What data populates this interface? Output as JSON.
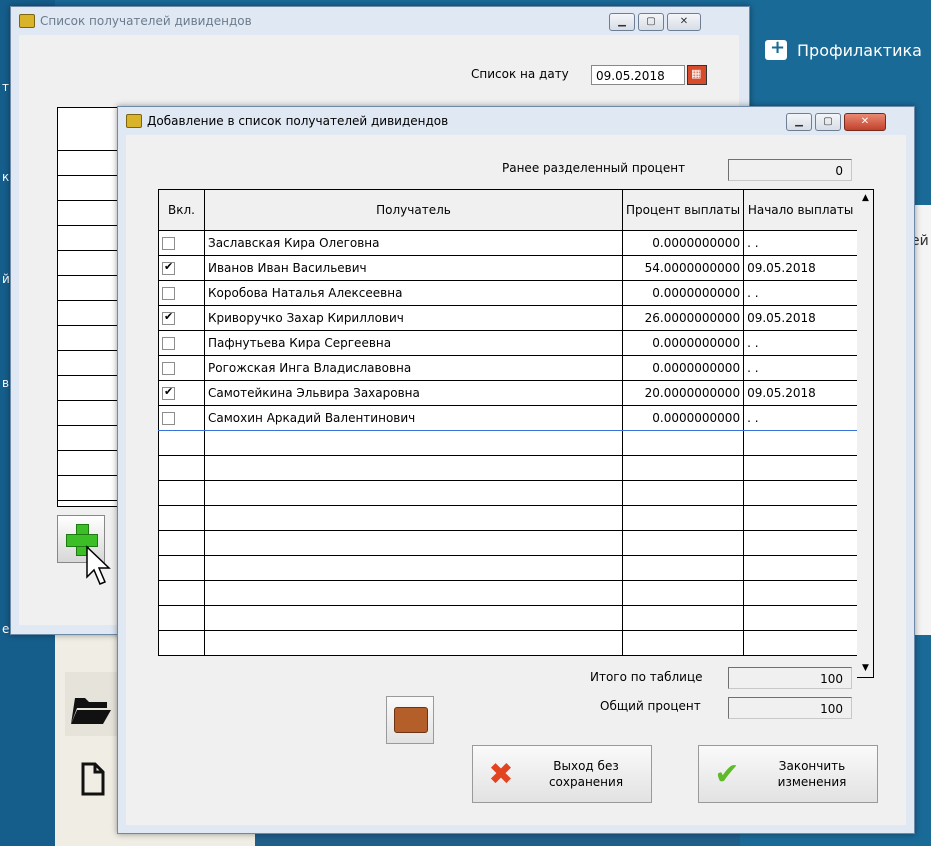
{
  "background": {
    "right_title": "Профилактика",
    "right_panel_text": "ей",
    "left_letters": [
      "т",
      "к",
      "й",
      "в",
      "е"
    ]
  },
  "window1": {
    "title": "Список получателей дивидендов",
    "date_label": "Список на дату",
    "date_value": "09.05.2018",
    "add_icon": "plus-icon"
  },
  "window2": {
    "title": "Добавление в список получателей дивидендов",
    "prev_percent_label": "Ранее разделенный процент",
    "prev_percent_value": "0",
    "columns": [
      "Вкл.",
      "Получатель",
      "Процент выплаты",
      "Начало выплаты"
    ],
    "rows": [
      {
        "checked": false,
        "name": "Заславская Кира Олеговна",
        "percent": "0.0000000000",
        "start": ". ."
      },
      {
        "checked": true,
        "name": "Иванов Иван Васильевич",
        "percent": "54.0000000000",
        "start": "09.05.2018"
      },
      {
        "checked": false,
        "name": "Коробова Наталья Алексеевна",
        "percent": "0.0000000000",
        "start": ". ."
      },
      {
        "checked": true,
        "name": "Криворучко Захар Кириллович",
        "percent": "26.0000000000",
        "start": "09.05.2018"
      },
      {
        "checked": false,
        "name": "Пафнутьева Кира Сергеевна",
        "percent": "0.0000000000",
        "start": ". ."
      },
      {
        "checked": false,
        "name": "Рогожская Инга Владиславовна",
        "percent": "0.0000000000",
        "start": ". ."
      },
      {
        "checked": true,
        "name": "Самотейкина Эльвира Захаровна",
        "percent": "20.0000000000",
        "start": "09.05.2018"
      },
      {
        "checked": false,
        "name": "Самохин Аркадий Валентинович",
        "percent": "0.0000000000",
        "start": ". ."
      }
    ],
    "total_label": "Итого по таблице",
    "total_value": "100",
    "overall_label": "Общий процент",
    "overall_value": "100",
    "exit_button": "Выход без сохранения",
    "finish_button": "Закончить изменения",
    "accent_colors": {
      "exit_icon": "#e2441f",
      "finish_icon": "#5dbb2a"
    }
  }
}
